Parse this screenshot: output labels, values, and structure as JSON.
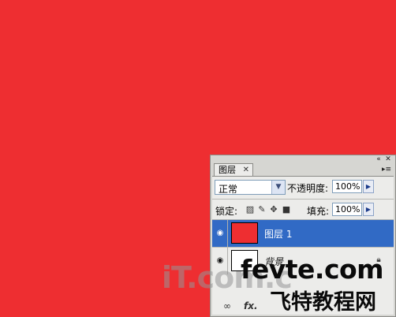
{
  "colors": {
    "canvas": "#ee2e31",
    "selection": "#316ac5",
    "layer1_thumb": "#ee2e31",
    "background_thumb": "#ffffff"
  },
  "panel": {
    "tab_label": "图层",
    "tab_close": "✕",
    "collapse_icon": "double-chevron-icon",
    "close_icon": "close-icon",
    "menu_icon": "panel-menu-icon",
    "blend_mode": "正常",
    "opacity_label": "不透明度:",
    "opacity_value": "100%",
    "lock_label": "锁定:",
    "fill_label": "填充:",
    "fill_value": "100%",
    "layers": [
      {
        "name": "图层 1",
        "selected": true,
        "thumb_color": "#ee2e31"
      },
      {
        "name": "背景",
        "selected": false,
        "thumb_color": "#ffffff"
      }
    ],
    "footer_fx": "fx."
  },
  "watermarks": {
    "itcom": "iT.com.c",
    "fevte": "fevte.com",
    "fevte_cn": "飞特教程网"
  }
}
